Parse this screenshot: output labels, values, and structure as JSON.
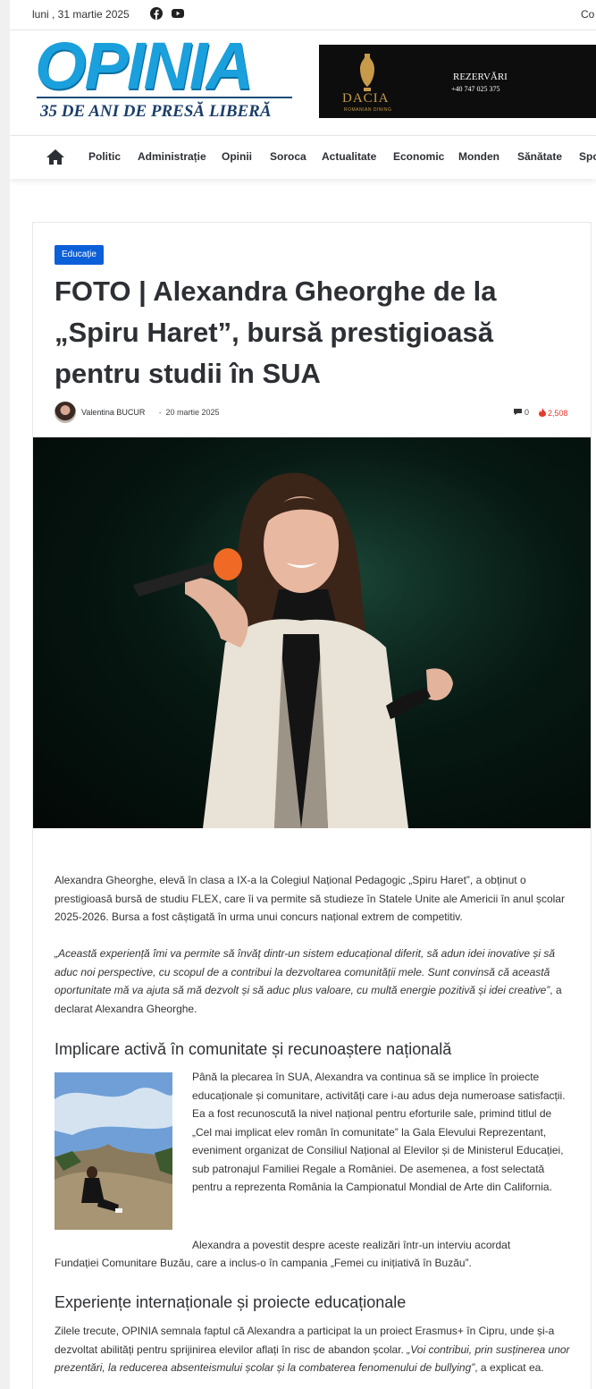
{
  "topbar": {
    "date": "luni , 31 martie 2025",
    "login_label": "Co"
  },
  "logo": {
    "main": "OPINIA",
    "tagline": "35 DE ANI DE PRESĂ LIBERĂ"
  },
  "ad": {
    "brand": "DACIA",
    "brand_sub": "ROMANIAN DINING",
    "reservation": "REZERVĂRI",
    "phone": "+40 747 025 375"
  },
  "nav": {
    "items": [
      "Politic",
      "Administrație",
      "Opinii",
      "Soroca",
      "Actualitate",
      "Economic",
      "Monden",
      "Sănătate",
      "Spo"
    ]
  },
  "article": {
    "category": "Educație",
    "title": "FOTO | Alexandra Gheorghe de la „Spiru Haret”, bursă prestigioasă pentru studii în SUA",
    "author": "Valentina BUCUR",
    "date": "20 martie 2025",
    "comments": "0",
    "views": "2,508",
    "p1": "Alexandra Gheorghe, elevă în clasa a IX-a la Colegiul Național Pedagogic „Spiru Haret”, a obținut o prestigioasă bursă de studiu FLEX, care îi va permite să studieze în Statele Unite ale Americii în anul școlar 2025-2026. Bursa a fost câștigată în urma unui concurs național extrem de competitiv.",
    "quote": "„Această experiență îmi va permite să învăț dintr-un sistem educațional diferit, să adun idei inovative și să aduc noi perspective, cu scopul de a contribui la dezvoltarea comunității mele. Sunt convinsă că această oportunitate mă va ajuta să mă dezvolt și să aduc plus valoare, cu multă energie pozitivă și idei creative”",
    "quote_suffix": ", a declarat Alexandra Gheorghe.",
    "h2_1": "Implicare activă în comunitate și recunoaștere națională",
    "p2": "Până la plecarea în SUA, Alexandra va continua să se implice în proiecte educaționale și comunitare, activități care i-au adus deja numeroase satisfacții. Ea a fost recunoscută la nivel național pentru eforturile sale, primind titlul de „Cel mai implicat elev român în comunitate” la Gala Elevului Reprezentant, eveniment organizat de Consiliul Național al Elevilor și de Ministerul Educației, sub patronajul Familiei Regale a României. De asemenea, a fost selectată pentru a reprezenta România la Campionatul Mondial de Arte din California.",
    "p3_line1": "Alexandra a povestit despre aceste realizări într-un interviu acordat",
    "p3_line2": "Fundației Comunitare Buzău, care a inclus-o în campania „Femei cu inițiativă în Buzău”.",
    "h2_2": "Experiențe internaționale și proiecte educaționale",
    "p4": "Zilele trecute, OPINIA semnala faptul că Alexandra a participat la un proiect Erasmus+ în Cipru, unde și-a dezvoltat abilități pentru sprijinirea elevilor aflați în risc de abandon școlar. ",
    "p4_quote": "„Voi contribui, prin susținerea unor prezentări, la reducerea absenteismului școlar și la combaterea fenomenului de bullying”",
    "p4_suffix": ", a explicat ea."
  },
  "colors": {
    "brand_blue": "#1aa0dc",
    "badge_blue": "#0b5fd8",
    "views_red": "#e3382c"
  }
}
